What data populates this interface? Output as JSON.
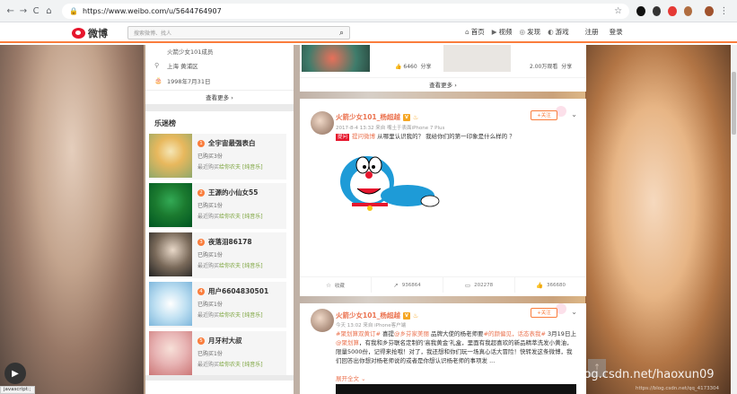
{
  "browser": {
    "url": "https://www.weibo.com/u/5644764907",
    "nav": {
      "back": "←",
      "forward": "→",
      "reload": "C",
      "home": "⌂"
    }
  },
  "weibo_nav": {
    "logo_text": "微博",
    "search_placeholder": "搜索微博、找人",
    "links": [
      {
        "icon": "⌂",
        "label": "首页"
      },
      {
        "icon": "▶",
        "label": "视频"
      },
      {
        "icon": "◎",
        "label": "发现"
      },
      {
        "icon": "◐",
        "label": "游戏"
      }
    ],
    "register": "注册",
    "login": "登录"
  },
  "profile_info": {
    "group_line": "火箭少女101成员",
    "location": "上海 黄浦区",
    "birthday": "1998年7月31日",
    "more": "查看更多 ›"
  },
  "music": {
    "title": "乐迷榜",
    "items": [
      {
        "rank": "1",
        "name": "全宇宙最强表白",
        "bought": "已购买3份",
        "recent": "最近购买",
        "tag": "[纯音乐]",
        "product": "给你农夫"
      },
      {
        "rank": "2",
        "name": "王源的小仙女55",
        "bought": "已购买1份",
        "recent": "最近购买",
        "tag": "[纯音乐]",
        "product": "给你农夫"
      },
      {
        "rank": "3",
        "name": "夜落泪86178",
        "bought": "已购买1份",
        "recent": "最近购买",
        "tag": "[纯音乐]",
        "product": "给你农夫"
      },
      {
        "rank": "4",
        "name": "用户6604830501",
        "bought": "已购买1份",
        "recent": "最近购买",
        "tag": "[纯音乐]",
        "product": "给你农夫"
      },
      {
        "rank": "5",
        "name": "月牙村大叔",
        "bought": "已购买1份",
        "recent": "最近购买",
        "tag": "[纯音乐]",
        "product": "给你农夫"
      }
    ]
  },
  "feed": {
    "top_card": {
      "views_left": "6460",
      "share_left": "分享",
      "views_right": "2.00万观看",
      "share_right": "分享",
      "more": "查看更多 ›"
    },
    "post1": {
      "name": "火箭少女101_杨超越",
      "badge_v": "V",
      "time": "2017-8-4 13:32 来自 嘴土于表面iPhone 7 Plus",
      "follow": "+关注",
      "q_tag": "提问",
      "text_prefix": "提问微博",
      "text": "从哪里认识我的？ 我给你们的第一印象是什么样的 ？",
      "actions": [
        {
          "icon": "☆",
          "label": "收藏"
        },
        {
          "icon": "↗",
          "label": "936864"
        },
        {
          "icon": "▭",
          "label": "202278"
        },
        {
          "icon": "👍",
          "label": "366680"
        }
      ]
    },
    "post2": {
      "name": "火箭少女101_杨超越",
      "badge_v": "V",
      "time": "今天 13:02 来自 iPhone客户端",
      "follow": "+关注",
      "text_1": "#聚划算双黄订#",
      "text_2": " 喜提",
      "text_3": "@乡芬家美丽",
      "text_4": " 品牌大使的杨老师要",
      "text_5": "#的颜偏见，话态表我#",
      "text_6": " 3月19日上",
      "text_7": "@聚划算",
      "text_8": "，有我和乡芬联名定制的'高我黄金'礼盒，里面有我超喜欢的新品精萃洗发小黄油，限量5000份，记得来抢哦！对了，我还想和你们玩一场真心话大冒险！快转发这条微博，我们回答出你想对杨老师说的或者是你想认识杨老师的事项发 ...",
      "expand": "展开全文 ⌄"
    }
  },
  "watermark": "https://blog.csdn.net/haoxun09",
  "watermark_small": "https://blog.csdn.net/qq_4173304",
  "status_bar": "javascript:;"
}
